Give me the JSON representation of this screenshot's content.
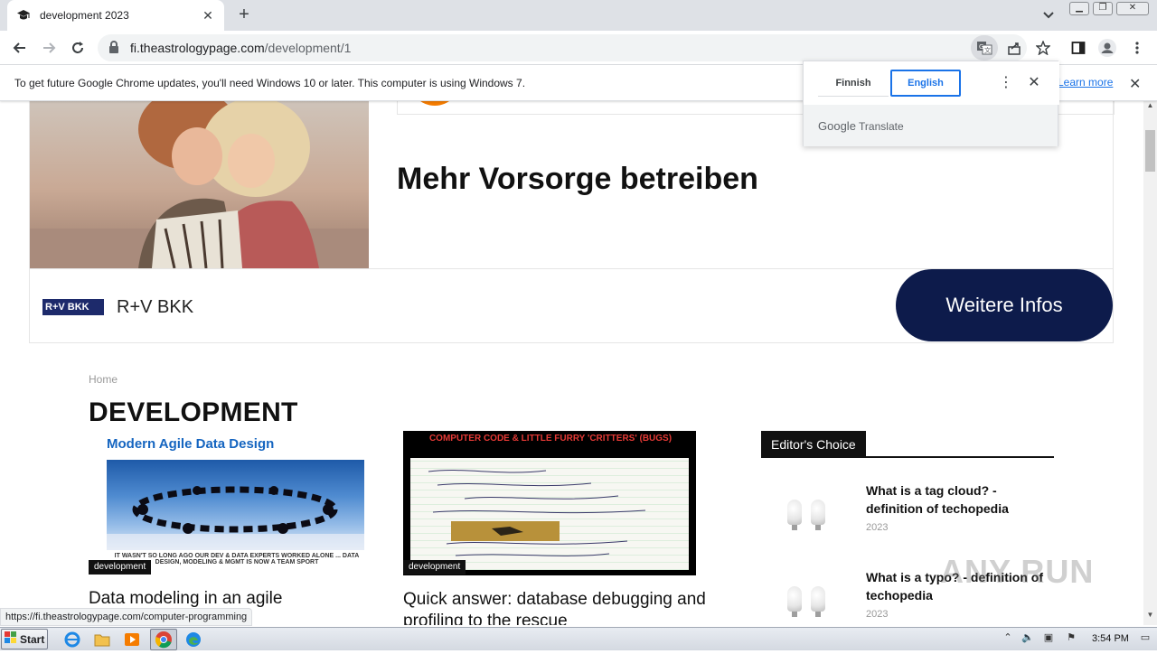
{
  "browser": {
    "tab_title": "development 2023",
    "tab_close": "✕",
    "new_tab": "+",
    "url_host": "fi.theastrologypage.com",
    "url_path": "/development/1"
  },
  "infobar": {
    "message": "To get future Google Chrome updates, you'll need Windows 10 or later. This computer is using Windows 7.",
    "link": "Learn more"
  },
  "translate": {
    "source_lang": "Finnish",
    "target_lang": "English",
    "brand_google": "Google",
    "brand_translate": "Translate"
  },
  "ad": {
    "headline": "Mehr Vorsorge betreiben",
    "logo_text": "R+V BKK",
    "brand": "R+V BKK",
    "cta": "Weitere Infos",
    "colors": {
      "cta_bg": "#0d1b4b",
      "accent": "#f57c00"
    }
  },
  "page": {
    "breadcrumb": "Home",
    "title": "DEVELOPMENT",
    "articles": [
      {
        "image_title": "Modern Agile Data Design",
        "image_caption": "IT WASN'T SO LONG AGO OUR DEV & DATA EXPERTS WORKED ALONE ... DATA DESIGN, MODELING & MGMT IS NOW A TEAM SPORT",
        "category": "development",
        "title": "Data modeling in an agile"
      },
      {
        "image_title": "COMPUTER CODE & LITTLE FURRY 'CRITTERS' (BUGS)",
        "category": "development",
        "title": "Quick answer: database debugging and profiling to the rescue"
      }
    ],
    "editors_choice": {
      "header": "Editor's Choice",
      "items": [
        {
          "title": "What is a tag cloud? - definition of techopedia",
          "year": "2023"
        },
        {
          "title": "What is a typo? - definition of techopedia",
          "year": "2023"
        }
      ]
    },
    "watermark": "ANY RUN"
  },
  "status_url": "https://fi.theastrologypage.com/computer-programming",
  "taskbar": {
    "start": "Start",
    "clock": "3:54 PM"
  }
}
